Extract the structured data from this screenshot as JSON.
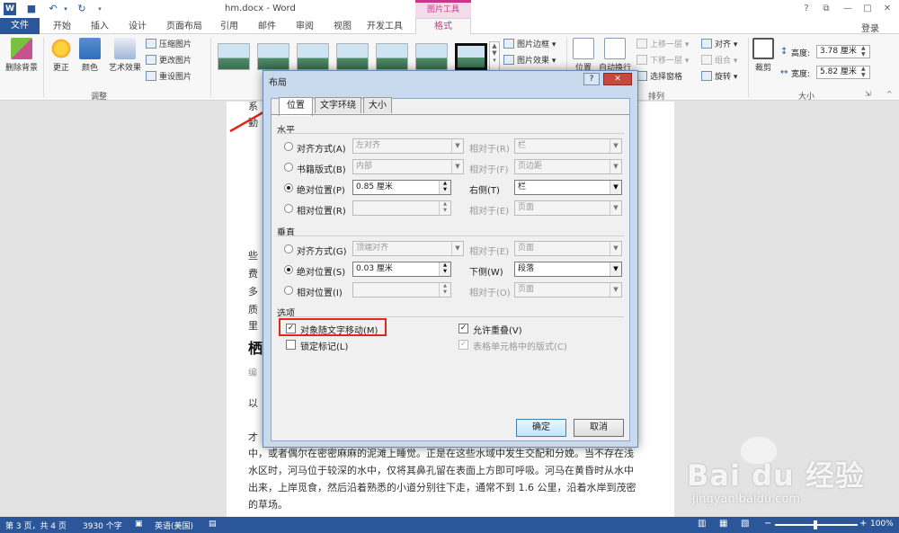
{
  "window": {
    "doc_title": "hm.docx - Word",
    "picture_tools_label": "图片工具",
    "help_label": "?",
    "restore_label": "⧉",
    "minimize_label": "—",
    "close_label": "✕",
    "login_label": "登录"
  },
  "tabs": [
    "文件",
    "开始",
    "插入",
    "设计",
    "页面布局",
    "引用",
    "邮件",
    "审阅",
    "视图",
    "开发工具",
    "格式"
  ],
  "ribbon": {
    "remove_bg": "删除背景",
    "corrections": "更正",
    "color": "颜色",
    "art_effects": "艺术效果",
    "compress": "压缩图片",
    "change": "更改图片",
    "reset": "重设图片",
    "adjust_group": "调整",
    "border": "图片边框",
    "effects": "图片效果",
    "position": "位置",
    "wrap": "自动换行",
    "forward": "上移一层",
    "backward": "下移一层",
    "selection_pane": "选择窗格",
    "align": "对齐",
    "group": "组合",
    "rotate": "旋转",
    "arrange_group": "排列",
    "crop": "裁剪",
    "height_label": "高度:",
    "height_value": "3.78 厘米",
    "width_label": "宽度:",
    "width_value": "5.82 厘米",
    "size_group": "大小"
  },
  "document": {
    "lines": [
      "中，或者偶尔在密密麻麻的泥滩上睡觉。正是在这些水域中发生交配和分娩。当不存在浅",
      "水区时，河马位于较深的水中，仅将其鼻孔留在表面上方即可呼吸。河马在黄昏时从水中",
      "出来，上岸觅食，然后沿着熟悉的小道分别往下走，通常不到 1.6 公里，沿着水岸到茂密",
      "的草场。"
    ],
    "left_fragments": [
      "系",
      "勤",
      "些",
      "费",
      "多",
      "质",
      "里",
      "栖",
      "编",
      "以",
      "才"
    ]
  },
  "dialog": {
    "title": "布局",
    "help": "?",
    "close": "✕",
    "tabs": [
      "位置",
      "文字环绕",
      "大小"
    ],
    "horizontal": "水平",
    "h_align": {
      "label": "对齐方式(A)",
      "value": "左对齐",
      "rel_label": "相对于(R)",
      "rel_value": "栏"
    },
    "h_book": {
      "label": "书籍版式(B)",
      "value": "内部",
      "rel_label": "相对于(F)",
      "rel_value": "页边距"
    },
    "h_abs": {
      "label": "绝对位置(P)",
      "value": "0.85 厘米",
      "rel_label": "右侧(T)",
      "rel_value": "栏"
    },
    "h_rel": {
      "label": "相对位置(R)",
      "value": "",
      "rel_label": "相对于(E)",
      "rel_value": "页面"
    },
    "vertical": "垂直",
    "v_align": {
      "label": "对齐方式(G)",
      "value": "顶端对齐",
      "rel_label": "相对于(E)",
      "rel_value": "页面"
    },
    "v_abs": {
      "label": "绝对位置(S)",
      "value": "0.03 厘米",
      "rel_label": "下侧(W)",
      "rel_value": "段落"
    },
    "v_rel": {
      "label": "相对位置(I)",
      "value": "",
      "rel_label": "相对于(O)",
      "rel_value": "页面"
    },
    "options": "选项",
    "move_with_text": "对象随文字移动(M)",
    "lock_anchor": "锁定标记(L)",
    "allow_overlap": "允许重叠(V)",
    "layout_in_cell": "表格单元格中的版式(C)",
    "ok": "确定",
    "cancel": "取消"
  },
  "status": {
    "page": "第 3 页，共 4 页",
    "words": "3930 个字",
    "lang": "英语(美国)",
    "zoom": "100%"
  },
  "watermark": {
    "brand": "Bai du 经验",
    "url": "jingyan.baidu.com"
  },
  "colors": {
    "accent": "#2b579a",
    "picture_tools": "#c7388d",
    "highlight": "#e0261d"
  }
}
